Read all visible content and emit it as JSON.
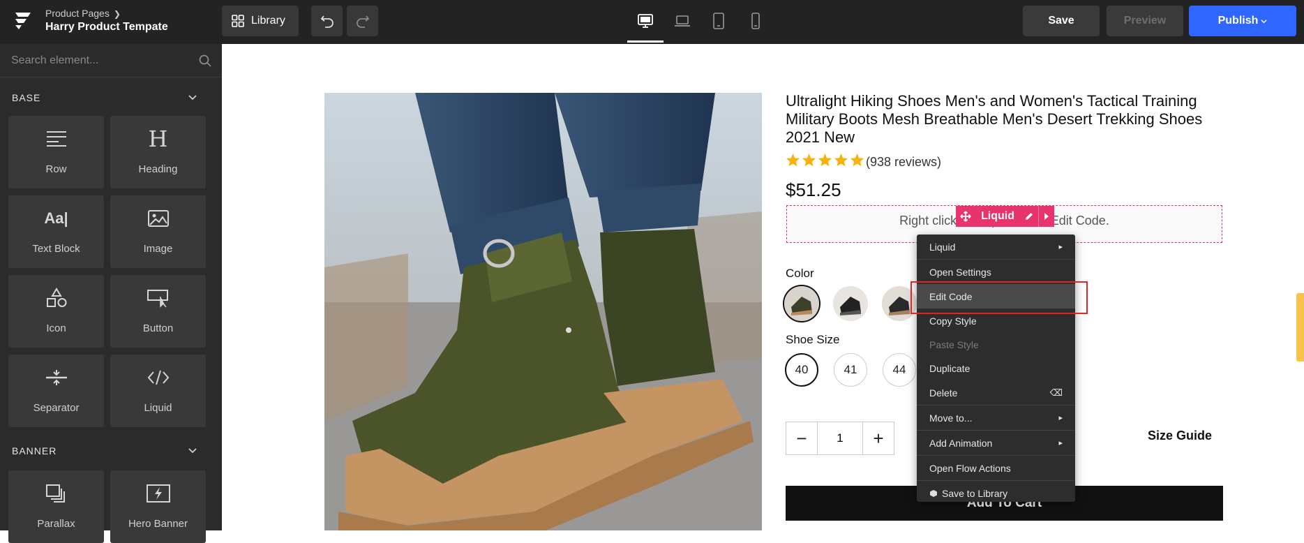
{
  "header": {
    "breadcrumb": "Product Pages",
    "page_name": "Harry Product Tempate",
    "library_label": "Library",
    "save_label": "Save",
    "preview_label": "Preview",
    "publish_label": "Publish",
    "accent": "#2f66ff"
  },
  "sidebar": {
    "search_placeholder": "Search element...",
    "sections": [
      {
        "title": "BASE"
      },
      {
        "title": "BANNER"
      }
    ],
    "tiles": [
      {
        "label": "Row",
        "icon": "row-icon"
      },
      {
        "label": "Heading",
        "icon": "heading-icon"
      },
      {
        "label": "Text Block",
        "icon": "text-block-icon"
      },
      {
        "label": "Image",
        "icon": "image-icon"
      },
      {
        "label": "Icon",
        "icon": "shapes-icon"
      },
      {
        "label": "Button",
        "icon": "button-icon"
      },
      {
        "label": "Separator",
        "icon": "separator-icon"
      },
      {
        "label": "Liquid",
        "icon": "code-icon"
      },
      {
        "label": "Parallax",
        "icon": "parallax-icon"
      },
      {
        "label": "Hero Banner",
        "icon": "hero-banner-icon"
      }
    ]
  },
  "product": {
    "title": "Ultralight Hiking Shoes Men's and Women's Tactical Training Military Boots Mesh Breathable Men's Desert Trekking Shoes 2021 New",
    "rating": 5,
    "reviews": "(938 reviews)",
    "price": "$51.25",
    "liquid_placeholder": "Right click on Liquid Box > Edit Code.",
    "liquid_badge": "Liquid",
    "color_label": "Color",
    "size_label": "Shoe Size",
    "sizes": [
      "40",
      "41",
      "44"
    ],
    "quantity": "1",
    "qty_minus": "−",
    "qty_plus": "+",
    "size_guide": "Size Guide",
    "add_to_cart": "Add To Cart"
  },
  "context_menu": {
    "items": [
      {
        "label": "Liquid",
        "arrow": "▸"
      },
      {
        "label": "Open Settings"
      },
      {
        "label": "Edit Code"
      },
      {
        "label": "Copy Style"
      },
      {
        "label": "Paste Style"
      },
      {
        "label": "Duplicate"
      },
      {
        "label": "Delete",
        "shortcut": "⌫"
      },
      {
        "label": "Move to...",
        "arrow": "▸"
      },
      {
        "label": "Add Animation",
        "arrow": "▸"
      },
      {
        "label": "Open Flow Actions"
      },
      {
        "label": "Save to Library"
      }
    ]
  }
}
